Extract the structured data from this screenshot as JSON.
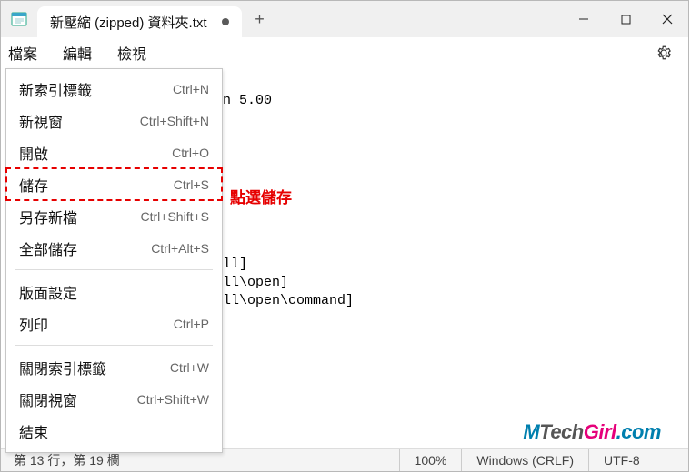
{
  "titlebar": {
    "app_icon": "notepad-icon",
    "tab_title": "新壓縮 (zipped) 資料夾.txt",
    "new_tab_glyph": "+"
  },
  "menubar": {
    "items": [
      "檔案",
      "編輯",
      "檢視"
    ]
  },
  "dropdown": {
    "items": [
      {
        "label": "新索引標籤",
        "shortcut": "Ctrl+N"
      },
      {
        "label": "新視窗",
        "shortcut": "Ctrl+Shift+N"
      },
      {
        "label": "開啟",
        "shortcut": "Ctrl+O"
      },
      {
        "label": "儲存",
        "shortcut": "Ctrl+S",
        "highlight": true
      },
      {
        "label": "另存新檔",
        "shortcut": "Ctrl+Shift+S"
      },
      {
        "label": "全部儲存",
        "shortcut": "Ctrl+Alt+S"
      }
    ],
    "items2": [
      {
        "label": "版面設定",
        "shortcut": ""
      },
      {
        "label": "列印",
        "shortcut": "Ctrl+P"
      }
    ],
    "items3": [
      {
        "label": "關閉索引標籤",
        "shortcut": "Ctrl+W"
      },
      {
        "label": "關閉視窗",
        "shortcut": "Ctrl+Shift+W"
      },
      {
        "label": "結束",
        "shortcut": ""
      }
    ]
  },
  "editor": {
    "line1": "n 5.00",
    "line2": "ll]",
    "line3": "ll\\open]",
    "line4": "ll\\open\\command]"
  },
  "annotation": "點選儲存",
  "status": {
    "position": "第 13 行，第 19 欄",
    "zoom": "100%",
    "lineending": "Windows (CRLF)",
    "encoding": "UTF-8"
  },
  "watermark": {
    "p1": "M",
    "p2": "Tech",
    "p3": "Girl",
    "p4": ".com"
  }
}
